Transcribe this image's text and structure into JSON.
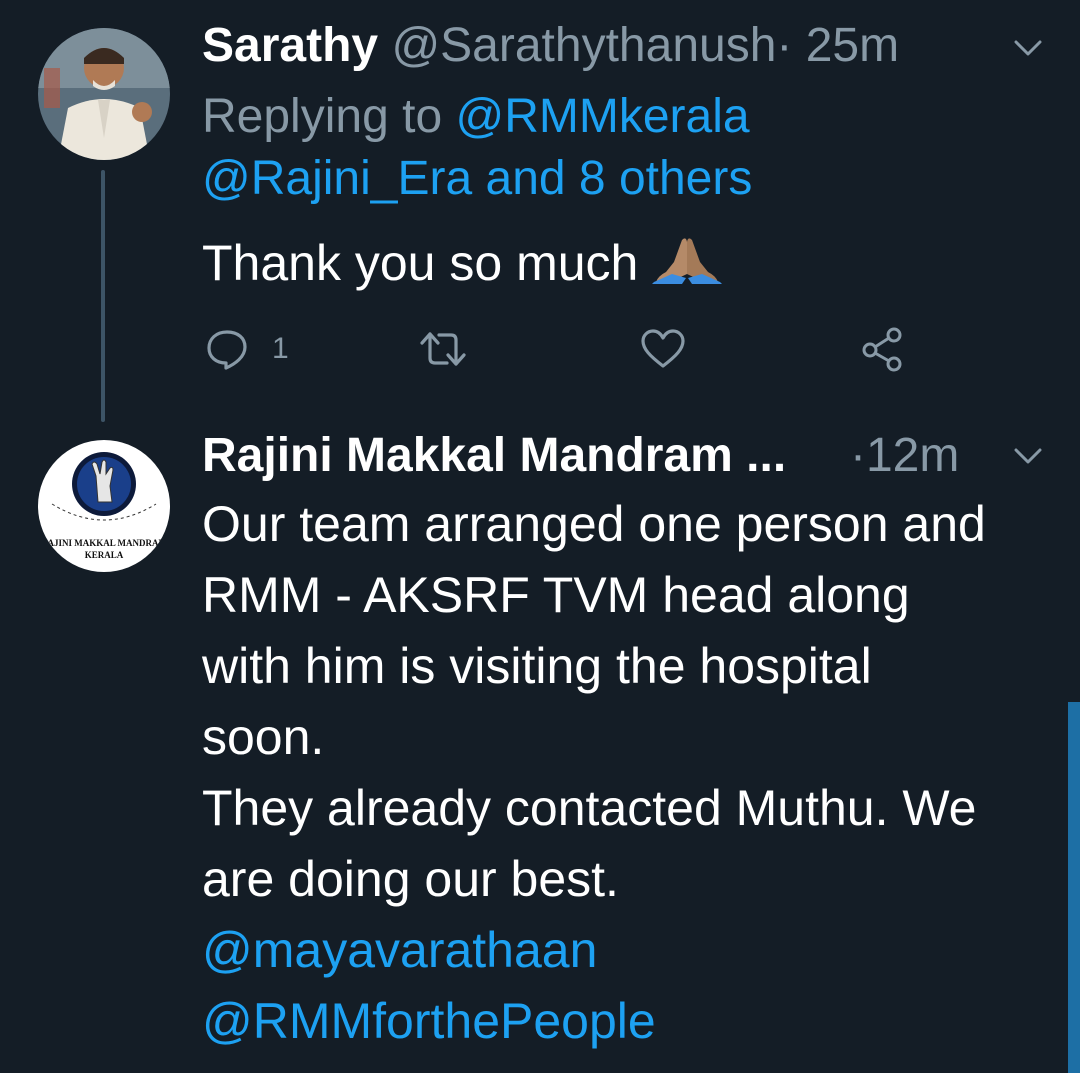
{
  "tweets": [
    {
      "name": "Sarathy",
      "handle": "@Sarathythanush",
      "separator": "·",
      "time": "25m",
      "replying_prefix": "Replying to ",
      "replying_user": "@RMMkerala",
      "replying_more": "@Rajini_Era and 8 others",
      "text": "Thank you so much ",
      "emoji": "folded-hands",
      "reply_count": "1"
    },
    {
      "name": "Rajini Makkal Mandram ...",
      "separator": "·",
      "time": "12m",
      "text": "Our team arranged one person and\nRMM - AKSRF TVM head along\nwith him is visiting the hospital\nsoon.\nThey already contacted Muthu. We\nare doing our best.",
      "mention1": "@mayavarathaan",
      "mention2": "@RMMforthePeople",
      "avatar_logo_text_line1": "RAJINI MAKKAL MANDRAM",
      "avatar_logo_text_line2": "KERALA"
    }
  ],
  "colors": {
    "background": "#141d26",
    "link": "#1da1f2",
    "muted": "#8899a6",
    "scrollbar": "#1d6fa5"
  },
  "icons": [
    "reply-icon",
    "retweet-icon",
    "like-icon",
    "share-icon",
    "chevron-down-icon",
    "folded-hands-emoji"
  ]
}
